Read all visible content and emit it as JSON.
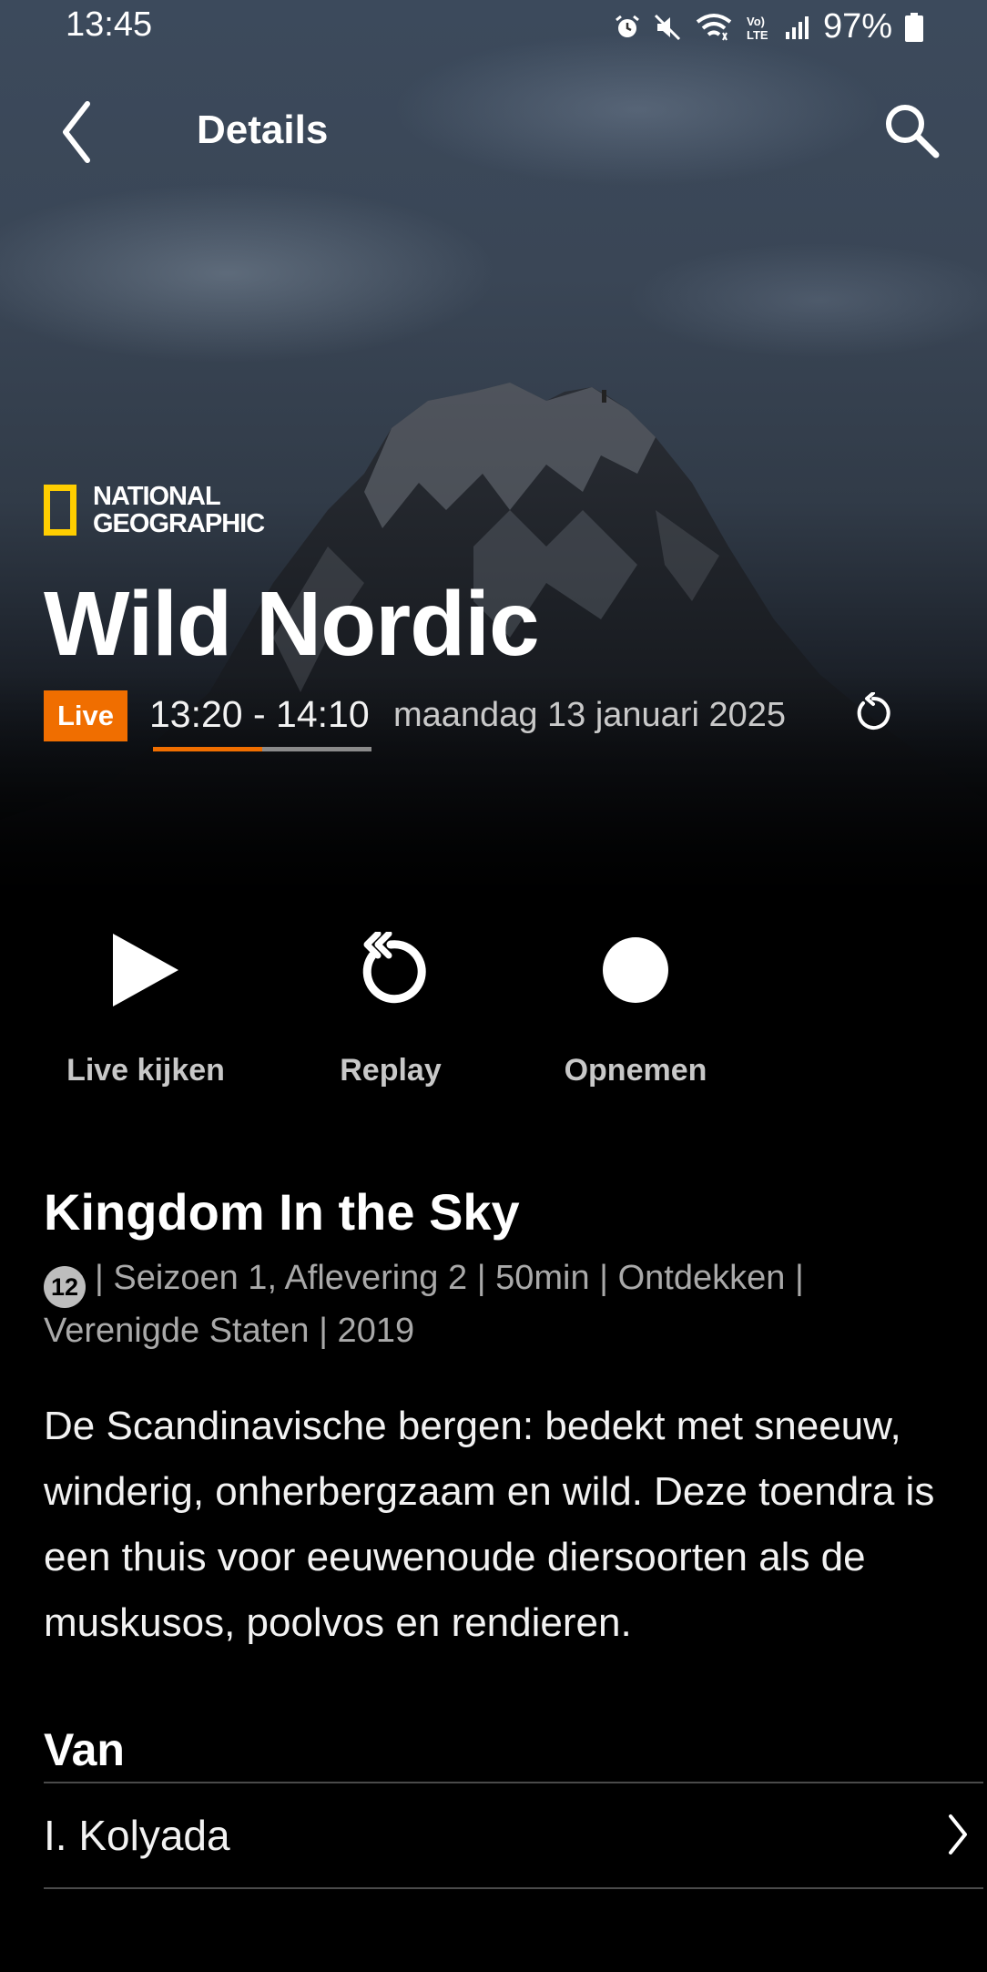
{
  "status_bar": {
    "time": "13:45",
    "battery": "97%",
    "icons": [
      "alarm-icon",
      "mute-icon",
      "wifi-icon",
      "volte-icon",
      "signal-icon",
      "battery-icon"
    ]
  },
  "app_bar": {
    "title": "Details",
    "back_icon": "chevron-left-icon",
    "search_icon": "search-icon"
  },
  "hero": {
    "channel_logo_lines": [
      "NATIONAL",
      "GEOGRAPHIC"
    ],
    "show_title": "Wild Nordic",
    "live_badge": "Live",
    "time_range": "13:20 - 14:10",
    "date": "maandag 13 januari 2025",
    "progress_fraction": 0.5
  },
  "actions": [
    {
      "label": "Live kijken",
      "icon": "play-icon"
    },
    {
      "label": "Replay",
      "icon": "replay-icon"
    },
    {
      "label": "Opnemen",
      "icon": "record-icon"
    }
  ],
  "episode": {
    "title": "Kingdom In the Sky",
    "age_rating": "12",
    "meta": "| Seizoen 1, Aflevering 2 | 50min | Ontdekken | Verenigde Staten | 2019",
    "description": "De Scandinavische bergen: bedekt met sneeuw, winderig, onherbergzaam en wild. Deze toendra is een thuis voor eeuwenoude diersoorten als de muskusos, poolvos en rendieren."
  },
  "credits": {
    "section_title": "Van",
    "people": [
      {
        "name": "I. Kolyada"
      }
    ]
  },
  "colors": {
    "accent_orange": "#f06e00",
    "ng_yellow": "#ffce00",
    "background": "#000000"
  }
}
